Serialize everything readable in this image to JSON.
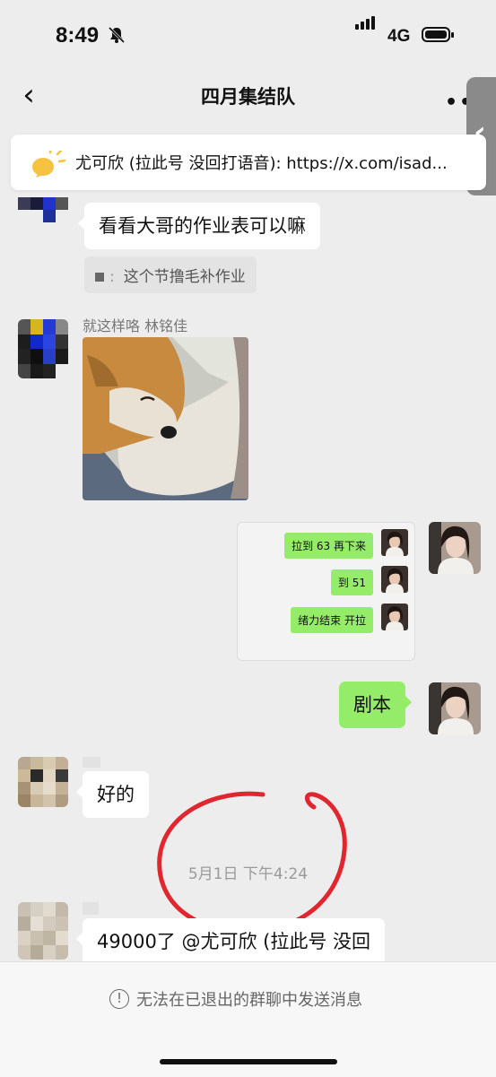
{
  "status_bar": {
    "time": "8:49",
    "network": "4G",
    "icons": [
      "bell-off-icon",
      "signal-icon",
      "battery-icon"
    ]
  },
  "nav": {
    "back_icon": "chevron-left-icon",
    "title": "四月集结队",
    "more_icon": "more-icon"
  },
  "pinned_notice": {
    "icon": "notice-icon",
    "text": "尤可欣 (拉此号 没回打语音): https://x.com/isad..."
  },
  "messages": {
    "m1": {
      "text": "看看大哥的作业表可以嘛",
      "quote": "这个节撸毛补作业"
    },
    "m2": {
      "sender": "就这样咯 林铭佳"
    },
    "m3": {
      "items": [
        {
          "text": "拉到 63 再下来"
        },
        {
          "text": "到 51"
        },
        {
          "text": "绪力结束 开拉"
        }
      ]
    },
    "m4": {
      "text": "剧本"
    },
    "m5": {
      "text": "好的"
    },
    "m6": {
      "text": "49000了 @尤可欣 (拉此号 没回"
    }
  },
  "timestamp": "5月1日 下午4:24",
  "footer": {
    "icon": "info-icon",
    "text": "无法在已退出的群聊中发送消息"
  },
  "colors": {
    "background": "#ededed",
    "bubble_out": "#95ec69",
    "bubble_in": "#ffffff",
    "annotation": "#e0262e"
  }
}
